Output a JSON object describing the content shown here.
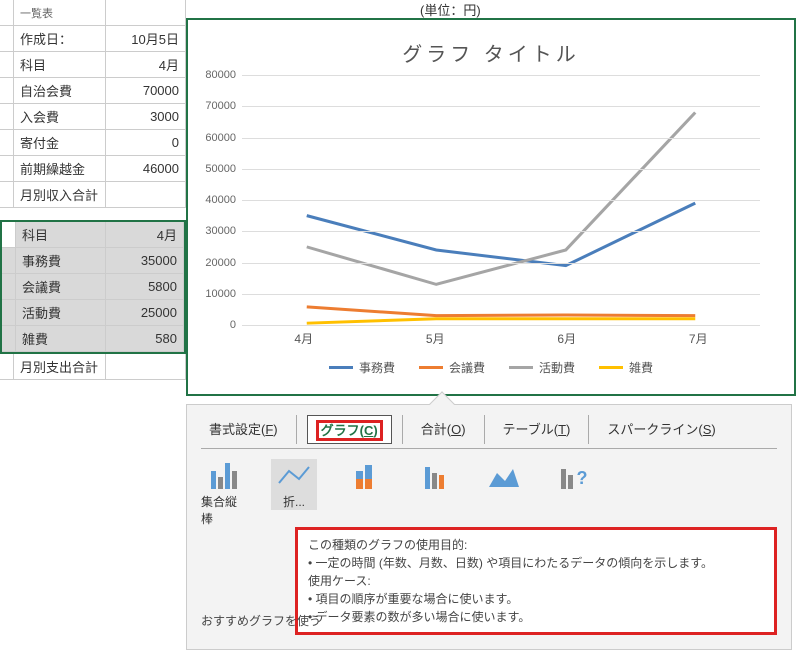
{
  "sheet": {
    "unit_label": "(単位：円)",
    "rows_top": [
      {
        "label": "作成日：",
        "val": "10月5日"
      },
      {
        "label": "科目",
        "val": "4月"
      },
      {
        "label": "自治会費",
        "val": "70000"
      },
      {
        "label": "入会費",
        "val": "3000"
      },
      {
        "label": "寄付金",
        "val": "0"
      },
      {
        "label": "前期繰越金",
        "val": "46000"
      },
      {
        "label": "月別収入合計",
        "val": ""
      }
    ],
    "rows_sel": [
      {
        "label": "科目",
        "val": "4月"
      },
      {
        "label": "事務費",
        "val": "35000"
      },
      {
        "label": "会議費",
        "val": "5800"
      },
      {
        "label": "活動費",
        "val": "25000"
      },
      {
        "label": "雑費",
        "val": "580"
      }
    ],
    "exp_total": "月別支出合計"
  },
  "chart_data": {
    "type": "line",
    "title": "グラフ タイトル",
    "categories": [
      "4月",
      "5月",
      "6月",
      "7月"
    ],
    "series": [
      {
        "name": "事務費",
        "color": "#4a7ebb",
        "values": [
          35000,
          24000,
          19000,
          39000
        ]
      },
      {
        "name": "会議費",
        "color": "#ed7d31",
        "values": [
          5800,
          3000,
          3200,
          3000
        ]
      },
      {
        "name": "活動費",
        "color": "#a5a5a5",
        "values": [
          25000,
          13000,
          24000,
          68000
        ]
      },
      {
        "name": "雑費",
        "color": "#ffc000",
        "values": [
          580,
          2000,
          2000,
          2000
        ]
      }
    ],
    "ylim": [
      0,
      80000
    ],
    "yticks": [
      0,
      10000,
      20000,
      30000,
      40000,
      50000,
      60000,
      70000,
      80000
    ]
  },
  "ribbon": {
    "tabs": [
      {
        "label": "書式設定",
        "key": "F"
      },
      {
        "label": "グラフ",
        "key": "C",
        "active": true
      },
      {
        "label": "合計",
        "key": "O"
      },
      {
        "label": "テーブル",
        "key": "T"
      },
      {
        "label": "スパークライン",
        "key": "S"
      }
    ],
    "types": {
      "clustered": "集合縦棒",
      "line": "折..."
    },
    "tooltip": {
      "l1": "この種類のグラフの使用目的:",
      "l2": "• 一定の時間 (年数、月数、日数) や項目にわたるデータの傾向を示します。",
      "l3": "使用ケース:",
      "l4": "• 項目の順序が重要な場合に使います。",
      "l5": "• データ要素の数が多い場合に使います。"
    },
    "reco": "おすすめグラフを使う"
  }
}
